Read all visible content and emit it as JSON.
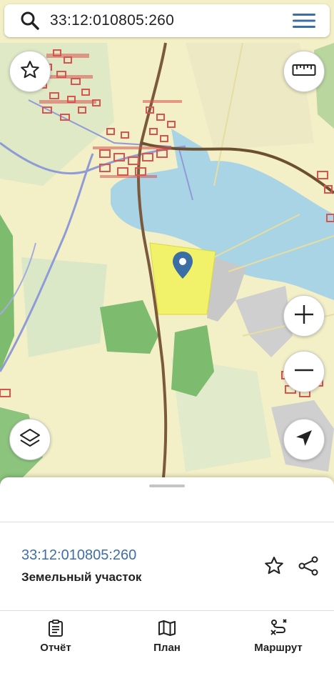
{
  "search": {
    "query": "33:12:010805:260"
  },
  "map": {
    "water_color": "#a9d4e6",
    "parcel_color": "#f2f26a",
    "marker_color": "#3b6ea5",
    "forest_color": "#7dbb6e",
    "railway_color": "#7a5a3a",
    "road_color": "#8f9bd6",
    "buildings_color": "#d9534f"
  },
  "sheet": {
    "parcel_number": "33:12:010805:260",
    "parcel_type": "Земельный участок"
  },
  "tabs": [
    {
      "label": "Отчёт",
      "icon": "report-icon"
    },
    {
      "label": "План",
      "icon": "map-plan-icon"
    },
    {
      "label": "Маршрут",
      "icon": "route-icon"
    }
  ]
}
